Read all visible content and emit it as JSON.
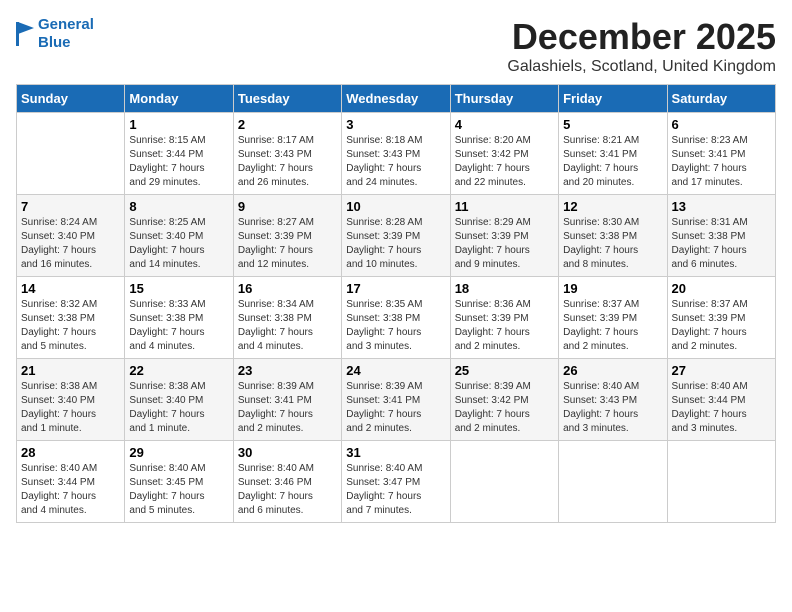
{
  "header": {
    "logo_line1": "General",
    "logo_line2": "Blue",
    "title": "December 2025",
    "subtitle": "Galashiels, Scotland, United Kingdom"
  },
  "calendar": {
    "weekdays": [
      "Sunday",
      "Monday",
      "Tuesday",
      "Wednesday",
      "Thursday",
      "Friday",
      "Saturday"
    ],
    "weeks": [
      [
        {
          "day": "",
          "info": ""
        },
        {
          "day": "1",
          "info": "Sunrise: 8:15 AM\nSunset: 3:44 PM\nDaylight: 7 hours\nand 29 minutes."
        },
        {
          "day": "2",
          "info": "Sunrise: 8:17 AM\nSunset: 3:43 PM\nDaylight: 7 hours\nand 26 minutes."
        },
        {
          "day": "3",
          "info": "Sunrise: 8:18 AM\nSunset: 3:43 PM\nDaylight: 7 hours\nand 24 minutes."
        },
        {
          "day": "4",
          "info": "Sunrise: 8:20 AM\nSunset: 3:42 PM\nDaylight: 7 hours\nand 22 minutes."
        },
        {
          "day": "5",
          "info": "Sunrise: 8:21 AM\nSunset: 3:41 PM\nDaylight: 7 hours\nand 20 minutes."
        },
        {
          "day": "6",
          "info": "Sunrise: 8:23 AM\nSunset: 3:41 PM\nDaylight: 7 hours\nand 17 minutes."
        }
      ],
      [
        {
          "day": "7",
          "info": "Sunrise: 8:24 AM\nSunset: 3:40 PM\nDaylight: 7 hours\nand 16 minutes."
        },
        {
          "day": "8",
          "info": "Sunrise: 8:25 AM\nSunset: 3:40 PM\nDaylight: 7 hours\nand 14 minutes."
        },
        {
          "day": "9",
          "info": "Sunrise: 8:27 AM\nSunset: 3:39 PM\nDaylight: 7 hours\nand 12 minutes."
        },
        {
          "day": "10",
          "info": "Sunrise: 8:28 AM\nSunset: 3:39 PM\nDaylight: 7 hours\nand 10 minutes."
        },
        {
          "day": "11",
          "info": "Sunrise: 8:29 AM\nSunset: 3:39 PM\nDaylight: 7 hours\nand 9 minutes."
        },
        {
          "day": "12",
          "info": "Sunrise: 8:30 AM\nSunset: 3:38 PM\nDaylight: 7 hours\nand 8 minutes."
        },
        {
          "day": "13",
          "info": "Sunrise: 8:31 AM\nSunset: 3:38 PM\nDaylight: 7 hours\nand 6 minutes."
        }
      ],
      [
        {
          "day": "14",
          "info": "Sunrise: 8:32 AM\nSunset: 3:38 PM\nDaylight: 7 hours\nand 5 minutes."
        },
        {
          "day": "15",
          "info": "Sunrise: 8:33 AM\nSunset: 3:38 PM\nDaylight: 7 hours\nand 4 minutes."
        },
        {
          "day": "16",
          "info": "Sunrise: 8:34 AM\nSunset: 3:38 PM\nDaylight: 7 hours\nand 4 minutes."
        },
        {
          "day": "17",
          "info": "Sunrise: 8:35 AM\nSunset: 3:38 PM\nDaylight: 7 hours\nand 3 minutes."
        },
        {
          "day": "18",
          "info": "Sunrise: 8:36 AM\nSunset: 3:39 PM\nDaylight: 7 hours\nand 2 minutes."
        },
        {
          "day": "19",
          "info": "Sunrise: 8:37 AM\nSunset: 3:39 PM\nDaylight: 7 hours\nand 2 minutes."
        },
        {
          "day": "20",
          "info": "Sunrise: 8:37 AM\nSunset: 3:39 PM\nDaylight: 7 hours\nand 2 minutes."
        }
      ],
      [
        {
          "day": "21",
          "info": "Sunrise: 8:38 AM\nSunset: 3:40 PM\nDaylight: 7 hours\nand 1 minute."
        },
        {
          "day": "22",
          "info": "Sunrise: 8:38 AM\nSunset: 3:40 PM\nDaylight: 7 hours\nand 1 minute."
        },
        {
          "day": "23",
          "info": "Sunrise: 8:39 AM\nSunset: 3:41 PM\nDaylight: 7 hours\nand 2 minutes."
        },
        {
          "day": "24",
          "info": "Sunrise: 8:39 AM\nSunset: 3:41 PM\nDaylight: 7 hours\nand 2 minutes."
        },
        {
          "day": "25",
          "info": "Sunrise: 8:39 AM\nSunset: 3:42 PM\nDaylight: 7 hours\nand 2 minutes."
        },
        {
          "day": "26",
          "info": "Sunrise: 8:40 AM\nSunset: 3:43 PM\nDaylight: 7 hours\nand 3 minutes."
        },
        {
          "day": "27",
          "info": "Sunrise: 8:40 AM\nSunset: 3:44 PM\nDaylight: 7 hours\nand 3 minutes."
        }
      ],
      [
        {
          "day": "28",
          "info": "Sunrise: 8:40 AM\nSunset: 3:44 PM\nDaylight: 7 hours\nand 4 minutes."
        },
        {
          "day": "29",
          "info": "Sunrise: 8:40 AM\nSunset: 3:45 PM\nDaylight: 7 hours\nand 5 minutes."
        },
        {
          "day": "30",
          "info": "Sunrise: 8:40 AM\nSunset: 3:46 PM\nDaylight: 7 hours\nand 6 minutes."
        },
        {
          "day": "31",
          "info": "Sunrise: 8:40 AM\nSunset: 3:47 PM\nDaylight: 7 hours\nand 7 minutes."
        },
        {
          "day": "",
          "info": ""
        },
        {
          "day": "",
          "info": ""
        },
        {
          "day": "",
          "info": ""
        }
      ]
    ]
  }
}
